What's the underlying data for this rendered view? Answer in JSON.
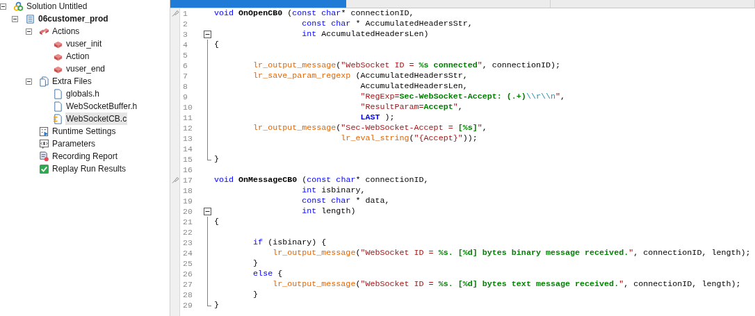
{
  "tree": [
    {
      "kind": "solution",
      "label": "Solution Untitled",
      "expanded": true,
      "selected": false,
      "children": [
        {
          "kind": "script",
          "label": "06customer_prod",
          "expanded": true,
          "selected": false,
          "children": [
            {
              "kind": "actions",
              "label": "Actions",
              "expanded": true,
              "selected": false,
              "children": [
                {
                  "kind": "action",
                  "label": "vuser_init",
                  "selected": false
                },
                {
                  "kind": "action",
                  "label": "Action",
                  "selected": false
                },
                {
                  "kind": "action",
                  "label": "vuser_end",
                  "selected": false
                }
              ]
            },
            {
              "kind": "folder",
              "label": "Extra Files",
              "expanded": true,
              "selected": false,
              "children": [
                {
                  "kind": "file",
                  "label": "globals.h",
                  "selected": false
                },
                {
                  "kind": "file",
                  "label": "WebSocketBuffer.h",
                  "selected": false
                },
                {
                  "kind": "source",
                  "label": "WebSocketCB.c",
                  "selected": true
                }
              ]
            },
            {
              "kind": "settings",
              "label": "Runtime Settings",
              "selected": false
            },
            {
              "kind": "parameters",
              "label": "Parameters",
              "selected": false
            },
            {
              "kind": "report",
              "label": "Recording Report",
              "selected": false
            },
            {
              "kind": "results",
              "label": "Replay Run Results",
              "selected": false
            }
          ]
        }
      ]
    }
  ],
  "tabs": [
    {
      "selected": true
    },
    {
      "selected": false
    },
    {
      "selected": false
    }
  ],
  "lines": [
    {
      "number": "1",
      "bookmark": true,
      "tokens": [
        {
          "kind": "keyword",
          "text": "void "
        },
        {
          "kind": "name",
          "text": "OnOpenCB0"
        },
        {
          "kind": "plain",
          "text": " ("
        },
        {
          "kind": "keyword",
          "text": "const char"
        },
        {
          "kind": "plain",
          "text": "* connectionID,"
        }
      ]
    },
    {
      "number": "2",
      "bookmark": false,
      "tokens": [
        {
          "kind": "keyword",
          "text": "                  const char"
        },
        {
          "kind": "plain",
          "text": " * AccumulatedHeadersStr,"
        }
      ]
    },
    {
      "number": "3",
      "bookmark": false,
      "fold": {
        "expanded": true
      },
      "tokens": [
        {
          "kind": "keyword",
          "text": "                  int"
        },
        {
          "kind": "plain",
          "text": " AccumulatedHeadersLen)"
        }
      ]
    },
    {
      "number": "4",
      "bookmark": false,
      "guide": true,
      "tokens": [
        {
          "kind": "plain",
          "text": "{"
        }
      ]
    },
    {
      "number": "5",
      "bookmark": false,
      "guide": true
    },
    {
      "number": "6",
      "bookmark": false,
      "guide": true,
      "tokens": [
        {
          "kind": "function",
          "text": "        lr_output_message"
        },
        {
          "kind": "plain",
          "text": "("
        },
        {
          "kind": "string",
          "text": "\"WebSocket ID = "
        },
        {
          "kind": "green",
          "text": "%s connected"
        },
        {
          "kind": "string",
          "text": "\""
        },
        {
          "kind": "plain",
          "text": ", connectionID);"
        }
      ]
    },
    {
      "number": "7",
      "bookmark": false,
      "guide": true,
      "tokens": [
        {
          "kind": "function",
          "text": "        lr_save_param_regexp"
        },
        {
          "kind": "plain",
          "text": " (AccumulatedHeadersStr,"
        }
      ]
    },
    {
      "number": "8",
      "bookmark": false,
      "guide": true,
      "tokens": [
        {
          "kind": "plain",
          "text": "                              AccumulatedHeadersLen,"
        }
      ]
    },
    {
      "number": "9",
      "bookmark": false,
      "guide": true,
      "tokens": [
        {
          "kind": "string",
          "text": "                              \"RegExp="
        },
        {
          "kind": "green",
          "text": "Sec-WebSocket-Accept: (.+)"
        },
        {
          "kind": "escape",
          "text": "\\\\r\\\\n"
        },
        {
          "kind": "string",
          "text": "\""
        },
        {
          "kind": "plain",
          "text": ","
        }
      ]
    },
    {
      "number": "10",
      "bookmark": false,
      "guide": true,
      "tokens": [
        {
          "kind": "string",
          "text": "                              \"ResultParam="
        },
        {
          "kind": "green",
          "text": "Accept"
        },
        {
          "kind": "string",
          "text": "\""
        },
        {
          "kind": "plain",
          "text": ","
        }
      ]
    },
    {
      "number": "11",
      "bookmark": false,
      "guide": true,
      "tokens": [
        {
          "kind": "constant",
          "text": "                              LAST"
        },
        {
          "kind": "plain",
          "text": " );"
        }
      ]
    },
    {
      "number": "12",
      "bookmark": false,
      "guide": true,
      "tokens": [
        {
          "kind": "function",
          "text": "        lr_output_message"
        },
        {
          "kind": "plain",
          "text": "("
        },
        {
          "kind": "string",
          "text": "\"Sec-WebSocket-Accept = "
        },
        {
          "kind": "green",
          "text": "[%s]"
        },
        {
          "kind": "string",
          "text": "\""
        },
        {
          "kind": "plain",
          "text": ","
        }
      ]
    },
    {
      "number": "13",
      "bookmark": false,
      "guide": true,
      "tokens": [
        {
          "kind": "function",
          "text": "                          lr_eval_string"
        },
        {
          "kind": "plain",
          "text": "("
        },
        {
          "kind": "string",
          "text": "\"{Accept}\""
        },
        {
          "kind": "plain",
          "text": "));"
        }
      ]
    },
    {
      "number": "14",
      "bookmark": false,
      "guide": true
    },
    {
      "number": "15",
      "bookmark": false,
      "guide_end": true,
      "tokens": [
        {
          "kind": "plain",
          "text": "}"
        }
      ]
    },
    {
      "number": "16",
      "bookmark": false
    },
    {
      "number": "17",
      "bookmark": true,
      "tokens": [
        {
          "kind": "keyword",
          "text": "void "
        },
        {
          "kind": "name",
          "text": "OnMessageCB0"
        },
        {
          "kind": "plain",
          "text": " ("
        },
        {
          "kind": "keyword",
          "text": "const char"
        },
        {
          "kind": "plain",
          "text": "* connectionID,"
        }
      ]
    },
    {
      "number": "18",
      "bookmark": false,
      "tokens": [
        {
          "kind": "keyword",
          "text": "                  int"
        },
        {
          "kind": "plain",
          "text": " isbinary,"
        }
      ]
    },
    {
      "number": "19",
      "bookmark": false,
      "tokens": [
        {
          "kind": "keyword",
          "text": "                  const char"
        },
        {
          "kind": "plain",
          "text": " * data,"
        }
      ]
    },
    {
      "number": "20",
      "bookmark": false,
      "fold": {
        "expanded": true
      },
      "tokens": [
        {
          "kind": "keyword",
          "text": "                  int"
        },
        {
          "kind": "plain",
          "text": " length)"
        }
      ]
    },
    {
      "number": "21",
      "bookmark": false,
      "guide": true,
      "tokens": [
        {
          "kind": "plain",
          "text": "{"
        }
      ]
    },
    {
      "number": "22",
      "bookmark": false,
      "guide": true
    },
    {
      "number": "23",
      "bookmark": false,
      "guide": true,
      "tokens": [
        {
          "kind": "keyword",
          "text": "        if"
        },
        {
          "kind": "plain",
          "text": " (isbinary) {"
        }
      ]
    },
    {
      "number": "24",
      "bookmark": false,
      "guide": true,
      "tokens": [
        {
          "kind": "function",
          "text": "            lr_output_message"
        },
        {
          "kind": "plain",
          "text": "("
        },
        {
          "kind": "string",
          "text": "\"WebSocket ID = "
        },
        {
          "kind": "green",
          "text": "%s. [%d] bytes binary message received."
        },
        {
          "kind": "string",
          "text": "\""
        },
        {
          "kind": "plain",
          "text": ", connectionID, length);"
        }
      ]
    },
    {
      "number": "25",
      "bookmark": false,
      "guide": true,
      "tokens": [
        {
          "kind": "plain",
          "text": "        }"
        }
      ]
    },
    {
      "number": "26",
      "bookmark": false,
      "guide": true,
      "tokens": [
        {
          "kind": "keyword",
          "text": "        else"
        },
        {
          "kind": "plain",
          "text": " {"
        }
      ]
    },
    {
      "number": "27",
      "bookmark": false,
      "guide": true,
      "tokens": [
        {
          "kind": "function",
          "text": "            lr_output_message"
        },
        {
          "kind": "plain",
          "text": "("
        },
        {
          "kind": "string",
          "text": "\"WebSocket ID = "
        },
        {
          "kind": "green",
          "text": "%s. [%d] bytes text message received."
        },
        {
          "kind": "string",
          "text": "\""
        },
        {
          "kind": "plain",
          "text": ", connectionID, length);"
        }
      ]
    },
    {
      "number": "28",
      "bookmark": false,
      "guide": true,
      "tokens": [
        {
          "kind": "plain",
          "text": "        }"
        }
      ]
    },
    {
      "number": "29",
      "bookmark": false,
      "guide_end": true,
      "tokens": [
        {
          "kind": "plain",
          "text": "}"
        }
      ]
    }
  ]
}
